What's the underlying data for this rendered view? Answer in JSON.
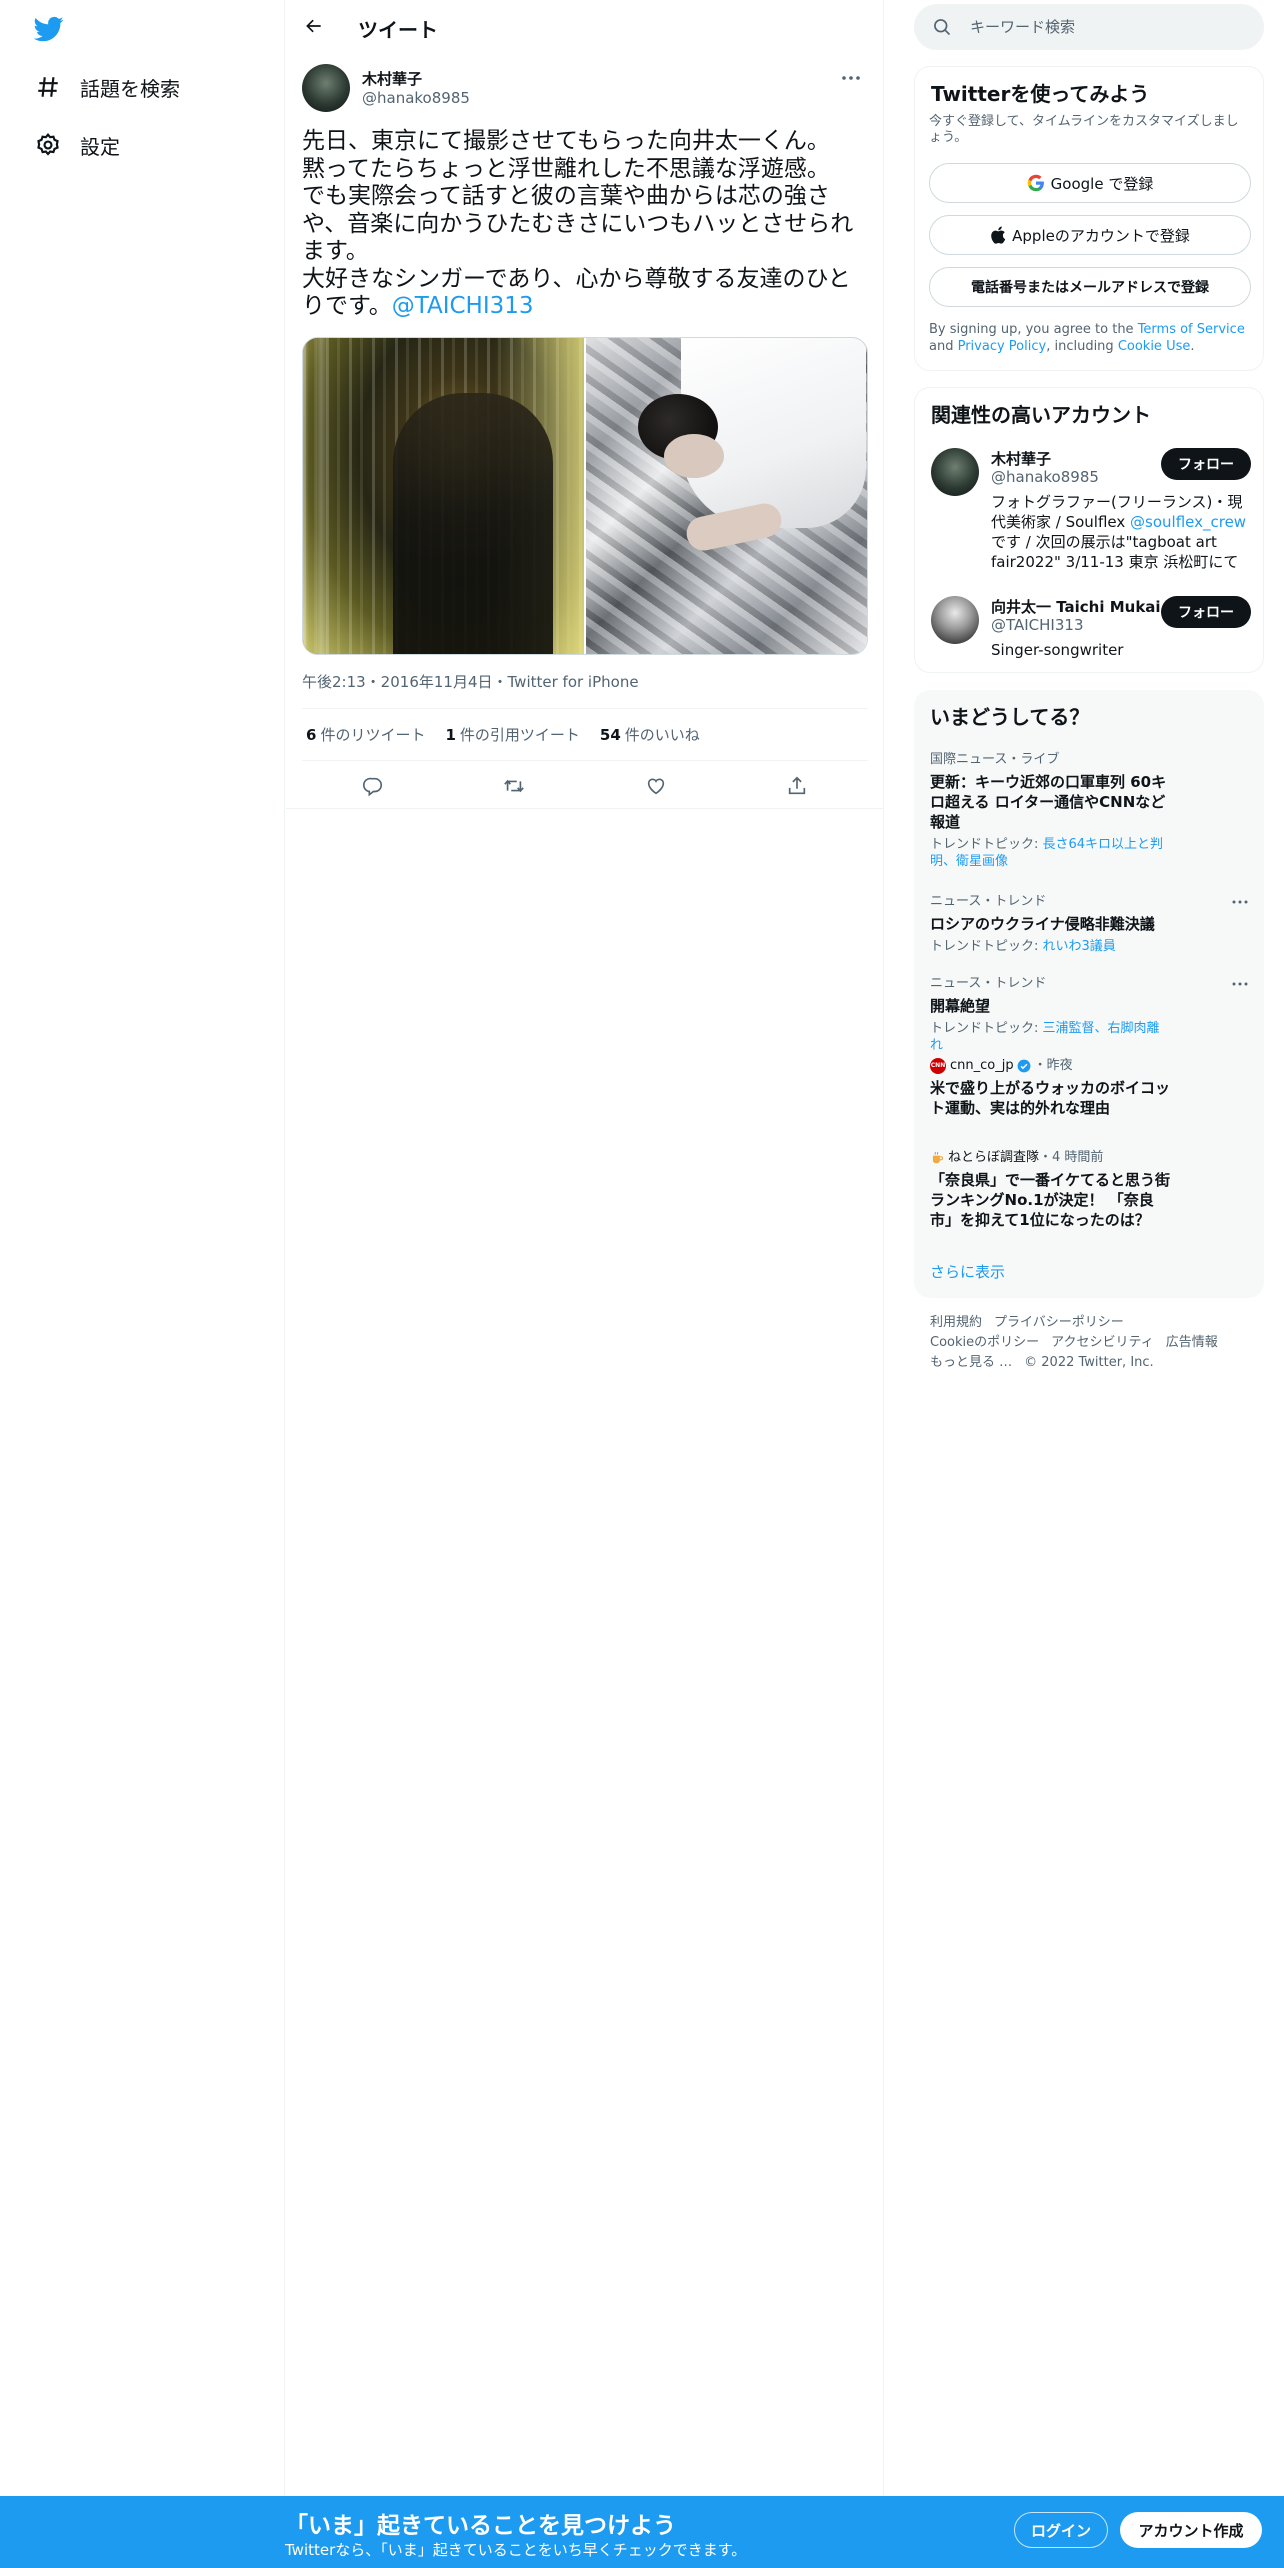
{
  "sidebar": {
    "items": [
      {
        "label": "話題を検索",
        "icon": "hashtag-icon"
      },
      {
        "label": "設定",
        "icon": "gear-icon"
      }
    ]
  },
  "header": {
    "title": "ツイート"
  },
  "tweet": {
    "author_name": "木村華子",
    "author_handle": "@hanako8985",
    "text_lines": [
      "先日、東京にて撮影させてもらった向井太一くん。",
      "黙ってたらちょっと浮世離れした不思議な浮遊感。",
      "でも実際会って話すと彼の言葉や曲からは芯の強さや、音楽に向かうひたむきさにいつもハッとさせられます。",
      "大好きなシンガーであり、心から尊敬する友達のひとりです。"
    ],
    "mention": "@TAICHI313",
    "timestamp": "午後2:13・2016年11月4日・",
    "source": "Twitter for iPhone",
    "stats": {
      "retweets": {
        "count": "6",
        "label": "件のリツイート"
      },
      "quotes": {
        "count": "1",
        "label": "件の引用ツイート"
      },
      "likes": {
        "count": "54",
        "label": "件のいいね"
      }
    }
  },
  "search": {
    "placeholder": "キーワード検索"
  },
  "signup": {
    "title": "Twitterを使ってみよう",
    "subtitle": "今すぐ登録して、タイムラインをカスタマイズしましょう。",
    "google_label": "Google で登録",
    "apple_label": "Appleのアカウントで登録",
    "phone_label": "電話番号またはメールアドレスで登録",
    "legal_prefix": "By signing up, you agree to the ",
    "terms": "Terms of Service",
    "and": " and ",
    "privacy": "Privacy Policy",
    "including": ", including ",
    "cookie": "Cookie Use",
    "period": "."
  },
  "related": {
    "title": "関連性の高いアカウント",
    "follow_label": "フォロー",
    "users": [
      {
        "name": "木村華子",
        "handle": "@hanako8985",
        "bio_before": "フォトグラファー(フリーランス)・現代美術家 / Soulflex ",
        "bio_link": "@soulflex_crew",
        "bio_after": " です / 次回の展示は\"tagboat art fair2022\" 3/11-13 東京 浜松町にて"
      },
      {
        "name": "向井太一 Taichi Mukai",
        "handle": "@TAICHI313",
        "bio": "Singer-songwriter"
      }
    ]
  },
  "trends": {
    "title": "いまどうしてる？",
    "items": [
      {
        "context": "国際ニュース・ライブ",
        "name": "更新：キーウ近郊の口軍車列 60キロ超える ロイター通信やCNNなど報道",
        "topics_prefix": "トレンドトピック: ",
        "topics": "長さ64キロ以上と判明、衛星画像"
      },
      {
        "context": "ニュース・トレンド",
        "name": "ロシアのウクライナ侵略非難決議",
        "topics_prefix": "トレンドトピック: ",
        "topics": "れいわ3議員"
      },
      {
        "context": "ニュース・トレンド",
        "name": "開幕絶望",
        "topics_prefix": "トレンドトピック: ",
        "topics": "三浦監督、右脚肉離れ"
      },
      {
        "account": "cnn_co_jp",
        "badge": "CNN",
        "time": "・昨夜",
        "name": "米で盛り上がるウォッカのボイコット運動、実は的外れな理由"
      },
      {
        "account": "ねとらぼ調査隊",
        "time": "・4 時間前",
        "name": "「奈良県」で一番イケてると思う街ランキングNo.1が決定！ 「奈良市」を抑えて1位になったのは？"
      }
    ],
    "show_more": "さらに表示"
  },
  "footer": {
    "links": [
      "利用規約",
      "プライバシーポリシー",
      "Cookieのポリシー",
      "アクセシビリティ",
      "広告情報",
      "もっと見る …"
    ],
    "copyright": "© 2022 Twitter, Inc."
  },
  "bottom_bar": {
    "title": "「いま」起きていることを見つけよう",
    "subtitle": "Twitterなら、「いま」起きていることをいち早くチェックできます。",
    "login": "ログイン",
    "signup": "アカウント作成"
  },
  "colors": {
    "accent": "#1d9bf0",
    "text": "#0f1419",
    "secondary": "#536471",
    "border": "#eff3f4"
  }
}
